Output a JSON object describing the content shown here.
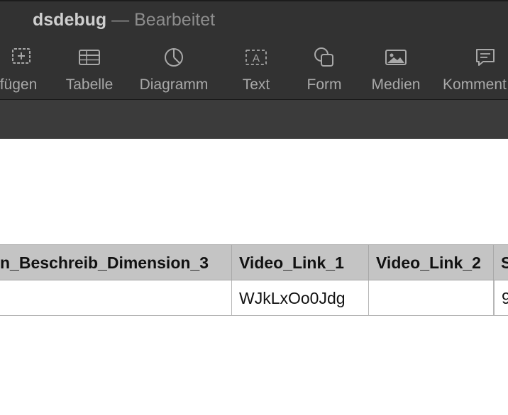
{
  "window": {
    "title": "dsdebug",
    "separator": "—",
    "status": "Bearbeitet"
  },
  "toolbar": {
    "items": [
      {
        "label": "fügen",
        "icon": "insert-icon"
      },
      {
        "label": "Tabelle",
        "icon": "table-icon"
      },
      {
        "label": "Diagramm",
        "icon": "chart-icon"
      },
      {
        "label": "Text",
        "icon": "textbox-icon"
      },
      {
        "label": "Form",
        "icon": "shape-icon"
      },
      {
        "label": "Medien",
        "icon": "media-icon"
      },
      {
        "label": "Komment",
        "icon": "comment-icon"
      }
    ]
  },
  "table": {
    "headers": [
      "n_Beschreib_Dimension_3",
      "Video_Link_1",
      "Video_Link_2",
      "S"
    ],
    "rows": [
      [
        "",
        "WJkLxOo0Jdg",
        "",
        "9"
      ]
    ]
  }
}
